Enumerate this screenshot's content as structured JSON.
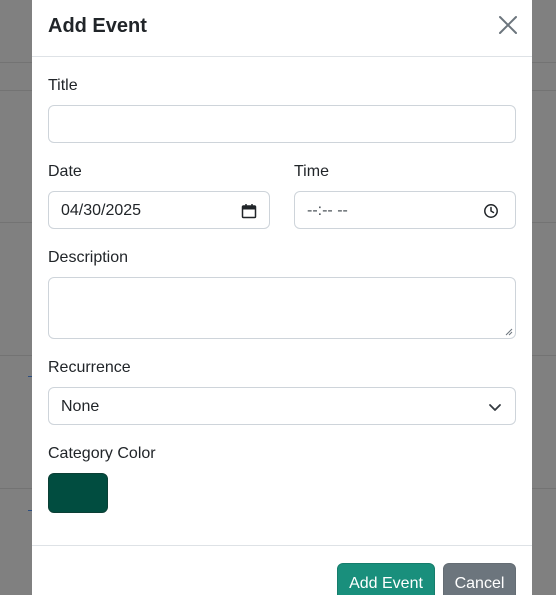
{
  "modal": {
    "title": "Add Event",
    "close_icon": "close-icon"
  },
  "form": {
    "title": {
      "label": "Title",
      "value": "",
      "placeholder": ""
    },
    "date": {
      "label": "Date",
      "value": "04/30/2025",
      "icon": "calendar-icon"
    },
    "time": {
      "label": "Time",
      "value": "--:-- --",
      "icon": "clock-icon"
    },
    "description": {
      "label": "Description",
      "value": ""
    },
    "recurrence": {
      "label": "Recurrence",
      "selected": "None",
      "icon": "chevron-down-icon"
    },
    "category_color": {
      "label": "Category Color",
      "value": "#014d40"
    }
  },
  "footer": {
    "submit_label": "Add Event",
    "cancel_label": "Cancel"
  },
  "colors": {
    "primary": "#198f7c",
    "secondary": "#6c757d",
    "swatch": "#014d40"
  }
}
